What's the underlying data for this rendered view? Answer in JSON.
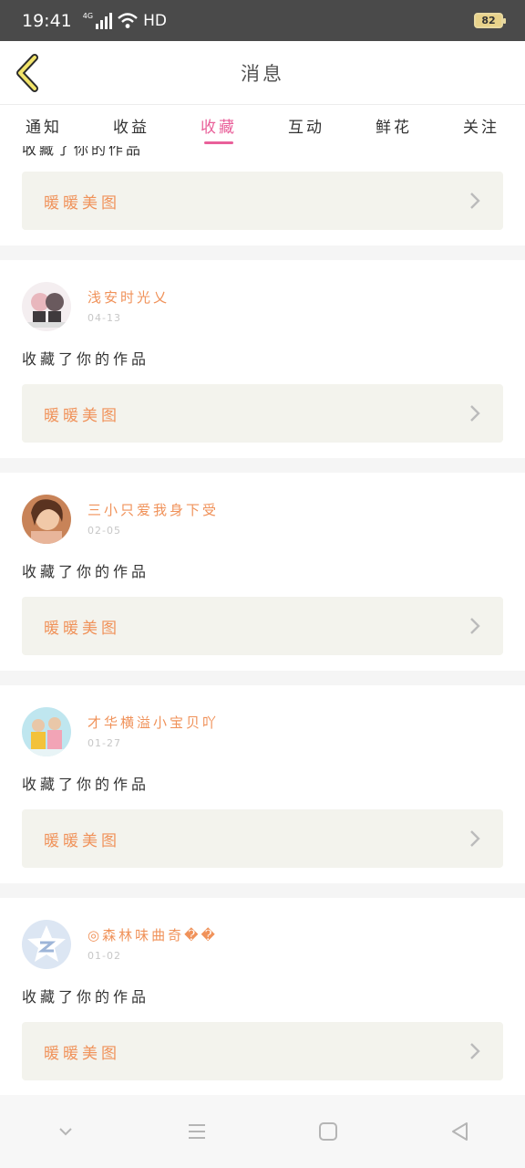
{
  "status_bar": {
    "time": "19:41",
    "network": "4G",
    "hd": "HD",
    "battery": "82"
  },
  "header": {
    "title": "消息"
  },
  "tabs": [
    {
      "label": "通知",
      "active": false
    },
    {
      "label": "收益",
      "active": false
    },
    {
      "label": "收藏",
      "active": true
    },
    {
      "label": "互动",
      "active": false
    },
    {
      "label": "鲜花",
      "active": false
    },
    {
      "label": "关注",
      "active": false
    }
  ],
  "top_card": {
    "link_label": "暖暖美图"
  },
  "messages": [
    {
      "username": "浅安时光乂",
      "date": "04-13",
      "action": "收藏了你的作品",
      "link_label": "暖暖美图"
    },
    {
      "username": "三小只爱我身下受",
      "date": "02-05",
      "action": "收藏了你的作品",
      "link_label": "暖暖美图"
    },
    {
      "username": "才华横溢小宝贝吖",
      "date": "01-27",
      "action": "收藏了你的作品",
      "link_label": "暖暖美图"
    },
    {
      "username": "◎森林味曲奇��",
      "date": "01-02",
      "action": "收藏了你的作品",
      "link_label": "暖暖美图"
    }
  ],
  "colors": {
    "accent": "#e9609a",
    "name": "#f0925a",
    "card_bg": "#f3f3ed",
    "status_bg": "#4a4a4a"
  }
}
